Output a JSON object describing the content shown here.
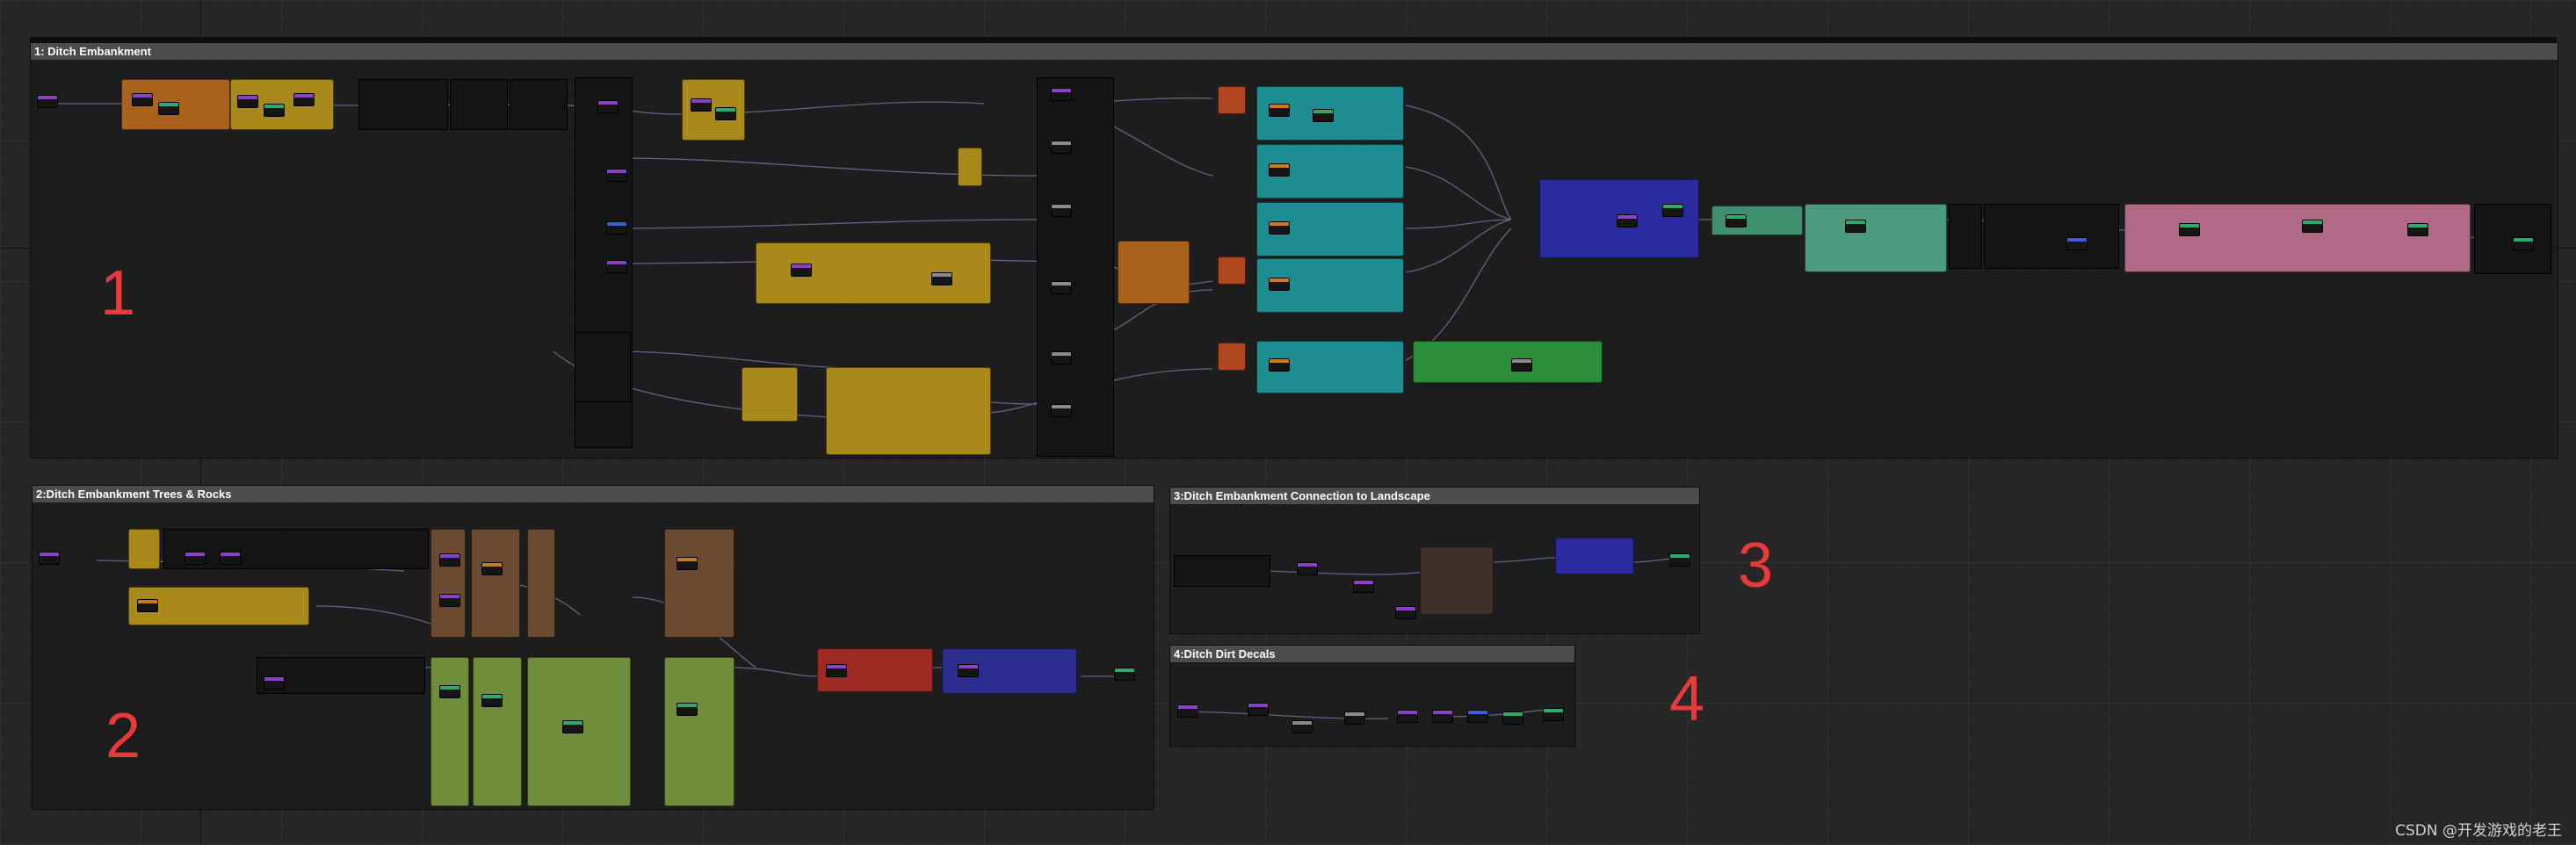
{
  "comments": {
    "c1": {
      "title": "1: Ditch Embankment"
    },
    "c2": {
      "title": "2:Ditch Embankment Trees & Rocks"
    },
    "c3": {
      "title": "3:Ditch Embankment Connection to Landscape"
    },
    "c4": {
      "title": "4:Ditch Dirt Decals"
    }
  },
  "annotations": {
    "n1": "1",
    "n2": "2",
    "n3": "3",
    "n4": "4"
  },
  "colors": {
    "annotation": "#e83a3a",
    "group_orange": "#a8621b",
    "group_yellow": "#a8891a",
    "group_teal": "#1d8d92",
    "group_green": "#2a8d3a",
    "group_navy": "#2c2c8e",
    "group_purple": "#2a2aa0",
    "group_pink": "#b06a86",
    "group_brown": "#6a4b2f",
    "group_lime": "#6f8d3a",
    "group_red": "#9c2a22",
    "group_seafoam": "#3f8f6f"
  },
  "watermark": "CSDN @开发游戏的老王"
}
